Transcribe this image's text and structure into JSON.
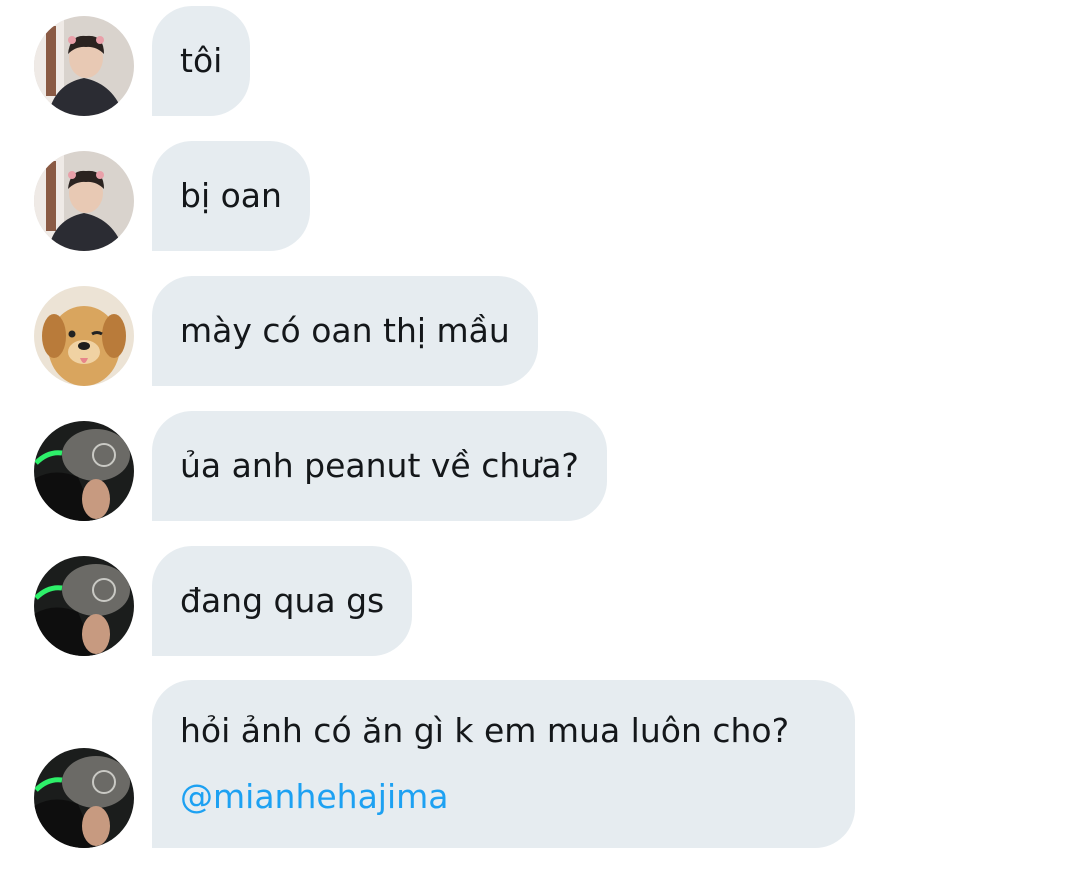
{
  "messages": [
    {
      "sender_avatar": "avatar-boy",
      "text": "tôi"
    },
    {
      "sender_avatar": "avatar-boy",
      "text": "bị oan"
    },
    {
      "sender_avatar": "avatar-dog",
      "text": "mày có oan thị mầu"
    },
    {
      "sender_avatar": "avatar-dark",
      "text": "ủa anh peanut về chưa?"
    },
    {
      "sender_avatar": "avatar-dark",
      "text": "đang qua gs"
    },
    {
      "sender_avatar": "avatar-dark",
      "text": "hỏi ảnh có ăn gì k em mua luôn cho?",
      "mention": "@mianhehajima"
    }
  ],
  "colors": {
    "bubble_bg": "#e6ecf0",
    "text": "#14171a",
    "mention": "#1da1f2"
  }
}
